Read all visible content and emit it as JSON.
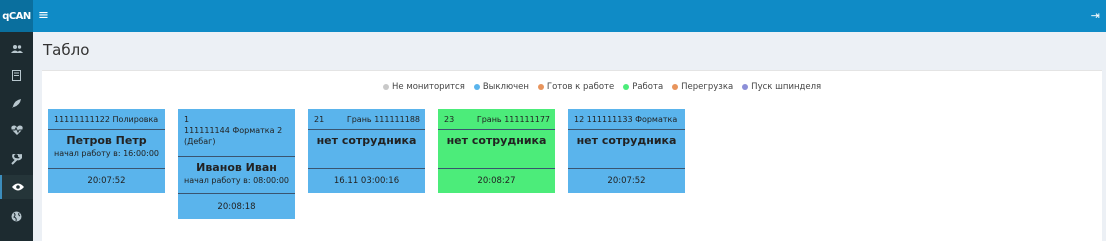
{
  "app": {
    "logo": "qCAN"
  },
  "header": {
    "menu_icon": "bars-icon",
    "logout_icon": "sign-out-icon"
  },
  "sidebar": {
    "items": [
      {
        "icon": "users-icon",
        "active": false
      },
      {
        "icon": "document-icon",
        "active": false
      },
      {
        "icon": "rocket-icon",
        "active": false
      },
      {
        "icon": "heartbeat-icon",
        "active": false
      },
      {
        "icon": "wrench-icon",
        "active": false
      },
      {
        "icon": "eye-icon",
        "active": true
      },
      {
        "icon": "globe-icon",
        "active": false
      }
    ]
  },
  "page": {
    "title": "Табло"
  },
  "legend": [
    {
      "label": "Не мониторится",
      "color": "#c9c9c9"
    },
    {
      "label": "Выключен",
      "color": "#5ab4ec"
    },
    {
      "label": "Готов к работе",
      "color": "#e8945c"
    },
    {
      "label": "Работа",
      "color": "#4cec7a"
    },
    {
      "label": "Перегрузка",
      "color": "#e8945c"
    },
    {
      "label": "Пуск шпинделя",
      "color": "#8c8fd8"
    }
  ],
  "cards": [
    {
      "head_left": "11111111122 Полировка",
      "head_right": "",
      "worker": "Петров Петр",
      "started": "начал работу в: 16:00:00",
      "time": "20:07:52",
      "status_color": "#5ab4ec"
    },
    {
      "head_left": "1\n111111144 Форматка 2 (Дебаг)",
      "head_right": "",
      "worker": "Иванов Иван",
      "started": "начал работу в: 08:00:00",
      "time": "20:08:18",
      "status_color": "#5ab4ec"
    },
    {
      "head_left": "21",
      "head_right": "Грань 111111188",
      "worker": "нет сотрудника",
      "started": "",
      "time": "16.11 03:00:16",
      "status_color": "#5ab4ec"
    },
    {
      "head_left": "23",
      "head_right": "Грань 111111177",
      "worker": "нет сотрудника",
      "started": "",
      "time": "20:08:27",
      "status_color": "#4cec7a"
    },
    {
      "head_left": "12 111111133 Форматка",
      "head_right": "",
      "worker": "нет сотрудника",
      "started": "",
      "time": "20:07:52",
      "status_color": "#5ab4ec"
    }
  ]
}
